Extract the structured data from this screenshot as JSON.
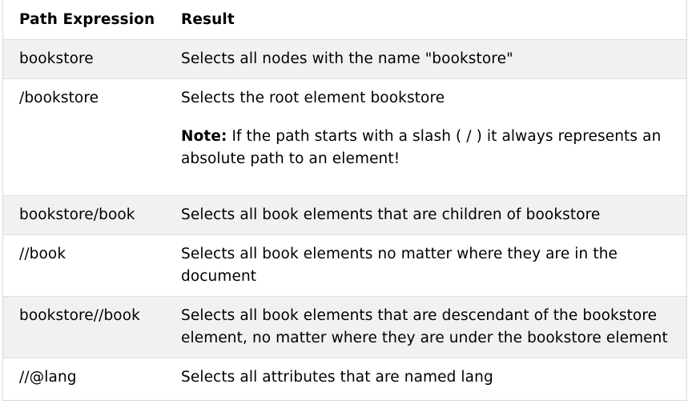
{
  "table": {
    "headers": {
      "path_expression": "Path Expression",
      "result": "Result"
    },
    "rows": [
      {
        "path": "bookstore",
        "result": "Selects all nodes with the name \"bookstore\""
      },
      {
        "path": "/bookstore",
        "result": "Selects the root element bookstore",
        "note_label": "Note:",
        "note_text": " If the path starts with a slash ( / ) it always represents an absolute path to an element!"
      },
      {
        "path": "bookstore/book",
        "result": "Selects all book elements that are children of bookstore"
      },
      {
        "path": "//book",
        "result": "Selects all book elements no matter where they are in the document"
      },
      {
        "path": "bookstore//book",
        "result": "Selects all book elements that are descendant of the bookstore element, no matter where they are under the bookstore element"
      },
      {
        "path": "//@lang",
        "result": "Selects all attributes that are named lang"
      }
    ]
  },
  "colors": {
    "shaded_row": "#f1f1f1",
    "border": "#dddddd",
    "text": "#000000"
  }
}
